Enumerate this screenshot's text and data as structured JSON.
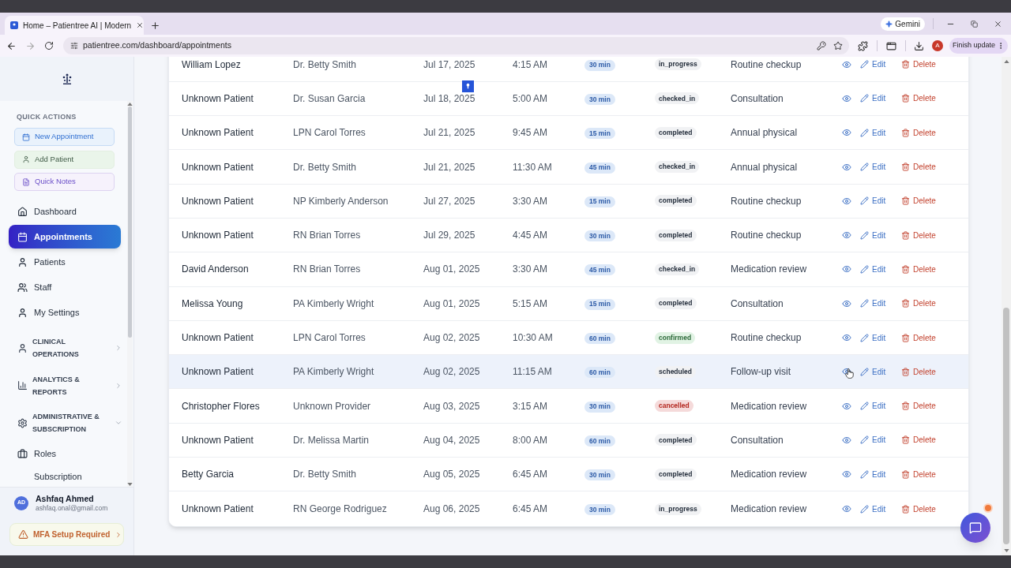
{
  "browser": {
    "tab_title": "Home – Patientree AI | Modern",
    "assistant_button": "Gemini",
    "url": "patientree.com/dashboard/appointments",
    "profile_initial": "A",
    "update_button": "Finish update"
  },
  "sidebar": {
    "quick_actions_title": "QUICK ACTIONS",
    "quick_actions": [
      {
        "label": "New Appointment",
        "kind": "appointment"
      },
      {
        "label": "Add Patient",
        "kind": "patient"
      },
      {
        "label": "Quick Notes",
        "kind": "notes"
      }
    ],
    "nav": [
      {
        "label": "Dashboard",
        "selected": false
      },
      {
        "label": "Appointments",
        "selected": true
      },
      {
        "label": "Patients",
        "selected": false
      },
      {
        "label": "Staff",
        "selected": false
      },
      {
        "label": "My Settings",
        "selected": false
      }
    ],
    "groups": [
      {
        "label": "CLINICAL OPERATIONS",
        "expanded": false
      },
      {
        "label": "ANALYTICS & REPORTS",
        "expanded": false
      },
      {
        "label": "ADMINISTRATIVE & SUBSCRIPTION",
        "expanded": true,
        "children": [
          {
            "label": "Roles"
          },
          {
            "label": "Subscription"
          }
        ]
      }
    ],
    "user": {
      "initials": "AD",
      "name": "Ashfaq Ahmed",
      "email": "ashfaq.onal@gmail.com"
    },
    "mfa_banner": "MFA Setup Required"
  },
  "table": {
    "rows": [
      {
        "column_1": "William Lopez",
        "column_2": "Dr. Betty Smith",
        "column_3": "Jul 17, 2025",
        "column_4": "4:15 AM",
        "column_5": "30 min",
        "column_6": {
          "text": "in_progress",
          "kind": "neutral"
        },
        "column_7": "Routine checkup",
        "edit": "Edit",
        "delete": "Delete",
        "hovered": false
      },
      {
        "column_1": "Unknown Patient",
        "column_2": "Dr. Susan Garcia",
        "column_3": "Jul 18, 2025",
        "column_4": "5:00 AM",
        "column_5": "30 min",
        "column_6": {
          "text": "checked_in",
          "kind": "neutral"
        },
        "column_7": "Consultation",
        "edit": "Edit",
        "delete": "Delete",
        "hovered": false
      },
      {
        "column_1": "Unknown Patient",
        "column_2": "LPN Carol Torres",
        "column_3": "Jul 21, 2025",
        "column_4": "9:45 AM",
        "column_5": "15 min",
        "column_6": {
          "text": "completed",
          "kind": "neutral"
        },
        "column_7": "Annual physical",
        "edit": "Edit",
        "delete": "Delete",
        "hovered": false
      },
      {
        "column_1": "Unknown Patient",
        "column_2": "Dr. Betty Smith",
        "column_3": "Jul 21, 2025",
        "column_4": "11:30 AM",
        "column_5": "45 min",
        "column_6": {
          "text": "checked_in",
          "kind": "neutral"
        },
        "column_7": "Annual physical",
        "edit": "Edit",
        "delete": "Delete",
        "hovered": false
      },
      {
        "column_1": "Unknown Patient",
        "column_2": "NP Kimberly Anderson",
        "column_3": "Jul 27, 2025",
        "column_4": "3:30 AM",
        "column_5": "15 min",
        "column_6": {
          "text": "completed",
          "kind": "neutral"
        },
        "column_7": "Routine checkup",
        "edit": "Edit",
        "delete": "Delete",
        "hovered": false
      },
      {
        "column_1": "Unknown Patient",
        "column_2": "RN Brian Torres",
        "column_3": "Jul 29, 2025",
        "column_4": "4:45 AM",
        "column_5": "30 min",
        "column_6": {
          "text": "completed",
          "kind": "neutral"
        },
        "column_7": "Routine checkup",
        "edit": "Edit",
        "delete": "Delete",
        "hovered": false
      },
      {
        "column_1": "David Anderson",
        "column_2": "RN Brian Torres",
        "column_3": "Aug 01, 2025",
        "column_4": "3:30 AM",
        "column_5": "45 min",
        "column_6": {
          "text": "checked_in",
          "kind": "neutral"
        },
        "column_7": "Medication review",
        "edit": "Edit",
        "delete": "Delete",
        "hovered": false
      },
      {
        "column_1": "Melissa Young",
        "column_2": "PA Kimberly Wright",
        "column_3": "Aug 01, 2025",
        "column_4": "5:15 AM",
        "column_5": "15 min",
        "column_6": {
          "text": "completed",
          "kind": "neutral"
        },
        "column_7": "Consultation",
        "edit": "Edit",
        "delete": "Delete",
        "hovered": false
      },
      {
        "column_1": "Unknown Patient",
        "column_2": "LPN Carol Torres",
        "column_3": "Aug 02, 2025",
        "column_4": "10:30 AM",
        "column_5": "60 min",
        "column_6": {
          "text": "confirmed",
          "kind": "success"
        },
        "column_7": "Routine checkup",
        "edit": "Edit",
        "delete": "Delete",
        "hovered": false
      },
      {
        "column_1": "Unknown Patient",
        "column_2": "PA Kimberly Wright",
        "column_3": "Aug 02, 2025",
        "column_4": "11:15 AM",
        "column_5": "60 min",
        "column_6": {
          "text": "scheduled",
          "kind": "neutral"
        },
        "column_7": "Follow-up visit",
        "edit": "Edit",
        "delete": "Delete",
        "hovered": true
      },
      {
        "column_1": "Christopher Flores",
        "column_2": "Unknown Provider",
        "column_3": "Aug 03, 2025",
        "column_4": "3:15 AM",
        "column_5": "30 min",
        "column_6": {
          "text": "cancelled",
          "kind": "danger"
        },
        "column_7": "Medication review",
        "edit": "Edit",
        "delete": "Delete",
        "hovered": false
      },
      {
        "column_1": "Unknown Patient",
        "column_2": "Dr. Melissa Martin",
        "column_3": "Aug 04, 2025",
        "column_4": "8:00 AM",
        "column_5": "60 min",
        "column_6": {
          "text": "completed",
          "kind": "neutral"
        },
        "column_7": "Consultation",
        "edit": "Edit",
        "delete": "Delete",
        "hovered": false
      },
      {
        "column_1": "Betty Garcia",
        "column_2": "Dr. Betty Smith",
        "column_3": "Aug 05, 2025",
        "column_4": "6:45 AM",
        "column_5": "30 min",
        "column_6": {
          "text": "completed",
          "kind": "neutral"
        },
        "column_7": "Medication review",
        "edit": "Edit",
        "delete": "Delete",
        "hovered": false
      },
      {
        "column_1": "Unknown Patient",
        "column_2": "RN George Rodriguez",
        "column_3": "Aug 06, 2025",
        "column_4": "6:45 AM",
        "column_5": "30 min",
        "column_6": {
          "text": "in_progress",
          "kind": "neutral"
        },
        "column_7": "Medication review",
        "edit": "Edit",
        "delete": "Delete",
        "hovered": false
      }
    ]
  }
}
